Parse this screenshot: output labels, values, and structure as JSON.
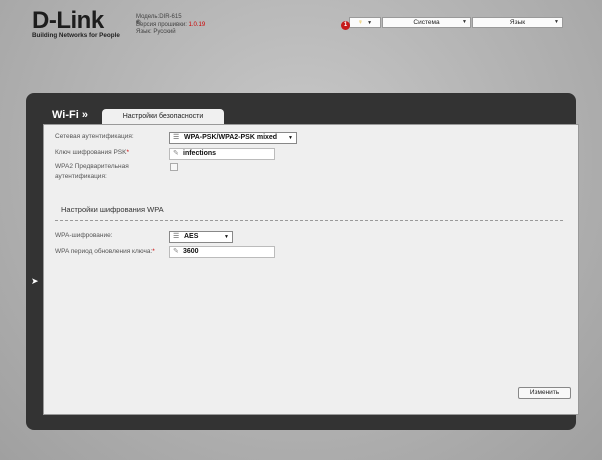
{
  "brand": {
    "logo": "D-Link",
    "tagline": "Building Networks for People"
  },
  "device": {
    "model": "Модель:DIR-615",
    "firmware_label": "Версия прошивки:",
    "firmware_value": "1.0.19",
    "language_info": "Язык: Русский"
  },
  "topbar": {
    "notifications_count": "1",
    "bulb_icon": "lightbulb-icon",
    "system_menu": "Система",
    "language_menu": "Язык"
  },
  "page": {
    "section_title": "Wi-Fi »",
    "tab_label": "Настройки безопасности",
    "subsection_title": "Настройки шифрования WPA"
  },
  "form": {
    "auth_label": "Сетевая аутентификация:",
    "auth_value": "WPA-PSK/WPA2-PSK mixed",
    "psk_label": "Ключ шифрования PSK",
    "psk_value": "infections",
    "wpa2_preauth_label_1": "WPA2 Предварительная",
    "wpa2_preauth_label_2": "аутентификация:",
    "wpa_encryption_label": "WPA-шифрование:",
    "wpa_encryption_value": "AES",
    "rekey_label": "WPA период обновления ключа:",
    "rekey_value": "3600"
  },
  "actions": {
    "change_button": "Изменить"
  },
  "colors": {
    "accent_red": "#c61a1a",
    "panel": "#333333",
    "content_bg": "#efefef"
  }
}
